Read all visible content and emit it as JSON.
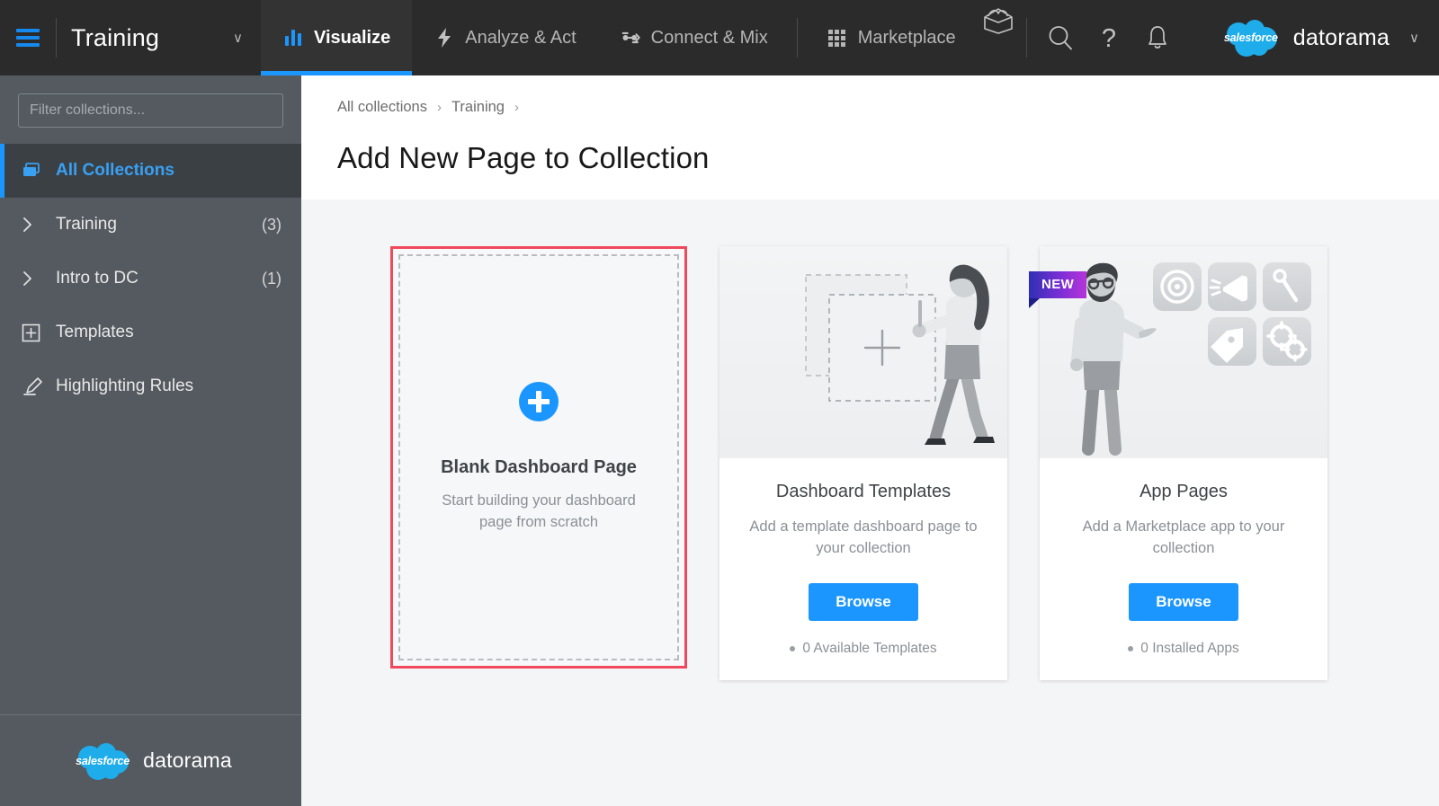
{
  "topbar": {
    "menu_icon": "hamburger-icon",
    "collection_name": "Training",
    "collection_caret": "∨",
    "tabs": [
      {
        "label": "Visualize",
        "icon": "bar-chart-icon",
        "active": true
      },
      {
        "label": "Analyze & Act",
        "icon": "lightning-bolt-icon",
        "active": false
      },
      {
        "label": "Connect & Mix",
        "icon": "connect-nodes-icon",
        "active": false
      },
      {
        "label": "Marketplace",
        "icon": "grid-icon",
        "active": false
      }
    ],
    "box_icon": "open-box-icon",
    "search_icon": "search-icon",
    "help_icon": "question-mark-icon",
    "notifications_icon": "bell-icon",
    "brand": {
      "cloud_text": "salesforce",
      "word": "datorama",
      "caret": "∨"
    },
    "accent": "#1b96ff",
    "bg": "#2b2b2b"
  },
  "sidebar": {
    "filter_placeholder": "Filter collections...",
    "filter_value": "",
    "items": [
      {
        "label": "All Collections",
        "icon": "collections-stack-icon",
        "count": "",
        "active": true,
        "expandable": false
      },
      {
        "label": "Training",
        "icon": "chevron-right-icon",
        "count": "(3)",
        "active": false,
        "expandable": true
      },
      {
        "label": "Intro to DC",
        "icon": "chevron-right-icon",
        "count": "(1)",
        "active": false,
        "expandable": true
      },
      {
        "label": "Templates",
        "icon": "plus-box-icon",
        "count": "",
        "active": false,
        "expandable": false
      },
      {
        "label": "Highlighting Rules",
        "icon": "highlighter-pen-icon",
        "count": "",
        "active": false,
        "expandable": false
      }
    ],
    "footer_brand": {
      "cloud_text": "salesforce",
      "word": "datorama"
    },
    "bg": "#545a60"
  },
  "main": {
    "breadcrumb": [
      "All collections",
      "Training"
    ],
    "breadcrumb_separator": "›",
    "page_title": "Add New Page to Collection",
    "cards": {
      "blank": {
        "title": "Blank Dashboard Page",
        "subtitle": "Start building your dashboard page from scratch",
        "icon": "plus-circle-icon",
        "highlight_color": "#f0485c",
        "highlighted": true
      },
      "templates": {
        "title": "Dashboard Templates",
        "subtitle": "Add a template dashboard page to your collection",
        "button_label": "Browse",
        "meta": "0 Available Templates",
        "illustration": "woman-placing-dashboard-template-illustration"
      },
      "apps": {
        "badge": "NEW",
        "title": "App Pages",
        "subtitle": "Add a Marketplace app to your collection",
        "button_label": "Browse",
        "meta": "0 Installed Apps",
        "illustration": "man-presenting-app-icons-illustration"
      }
    }
  }
}
